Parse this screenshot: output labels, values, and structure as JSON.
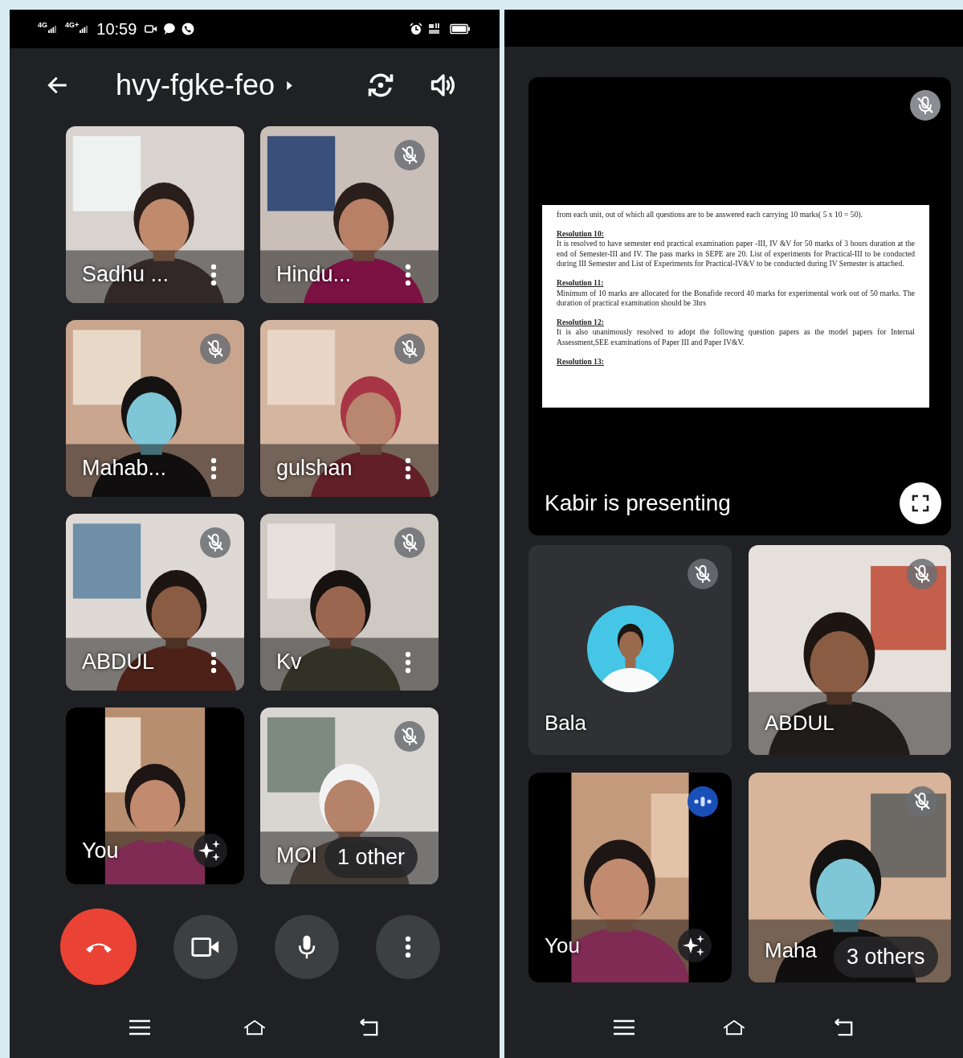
{
  "left_phone": {
    "status_bar": {
      "networks": [
        "4G",
        "4G+"
      ],
      "time": "10:59"
    },
    "meeting": {
      "title": "hvy-fgke-feo"
    },
    "tiles": [
      {
        "name": "Sadhu ...",
        "kind": "video",
        "muted": false,
        "menu": true
      },
      {
        "name": "Hindu...",
        "kind": "video",
        "muted": true,
        "menu": true
      },
      {
        "name": "Mahab...",
        "kind": "video",
        "muted": true,
        "menu": true
      },
      {
        "name": "gulshan",
        "kind": "video",
        "muted": true,
        "menu": true
      },
      {
        "name": "ABDUL",
        "kind": "video",
        "muted": true,
        "menu": true
      },
      {
        "name": "Kv",
        "kind": "video",
        "muted": true,
        "menu": true
      },
      {
        "name": "You",
        "kind": "video",
        "muted": false,
        "effects": true
      },
      {
        "name": "MOI",
        "kind": "video",
        "muted": true,
        "others": "1 other"
      }
    ],
    "controls": [
      {
        "kind": "end_call"
      },
      {
        "kind": "camera"
      },
      {
        "kind": "mic"
      },
      {
        "kind": "more"
      }
    ]
  },
  "right_phone": {
    "presentation": {
      "caption": "Kabir is presenting",
      "muted": true,
      "document": [
        {
          "kind": "paragraph",
          "text": "from each unit, out of which all questions are to be answered each carrying 10 marks( 5 x 10 = 50)."
        },
        {
          "kind": "heading",
          "text": "Resolution 10:"
        },
        {
          "kind": "paragraph",
          "text": "It is resolved to have semester end practical examination paper -III, IV &V for 50 marks of 3 hours duration at the end of Semester-III and IV. The pass marks in SEPE are 20. List of experiments for Practical-III to be conducted during III Semester and List of Experiments for Practical-IV&V to be conducted during IV Semester is attached."
        },
        {
          "kind": "heading",
          "text": "Resolution 11:"
        },
        {
          "kind": "paragraph",
          "text": "Minimum of 10 marks are allocated for the Bonafide record 40 marks for experimental work out of 50 marks. The duration of practical examination should be 3hrs"
        },
        {
          "kind": "heading",
          "text": "Resolution 12:"
        },
        {
          "kind": "paragraph",
          "text": "It is also unanimously resolved to adopt the following question papers as the model papers for Internal Assessment,SEE examinations of Paper III and Paper IV&V."
        },
        {
          "kind": "heading",
          "text": "Resolution 13:"
        }
      ]
    },
    "tiles": [
      {
        "name": "Bala",
        "kind": "avatar",
        "muted": true
      },
      {
        "name": "ABDUL",
        "kind": "video",
        "muted": true
      },
      {
        "name": "You",
        "kind": "video",
        "muted": false,
        "speaking": true,
        "effects": true
      },
      {
        "name": "Maha",
        "kind": "video",
        "muted": true,
        "others": "3 others"
      }
    ]
  }
}
